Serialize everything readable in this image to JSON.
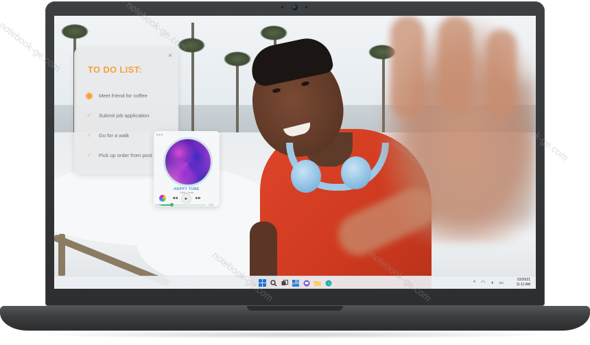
{
  "todo": {
    "title": "TO DO LIST:",
    "close": "×",
    "items": [
      {
        "label": "Meet friend for coffee",
        "done": false
      },
      {
        "label": "Submit job application",
        "done": true
      },
      {
        "label": "Go for a walk",
        "done": true
      },
      {
        "label": "Pick up order from post o",
        "done": true
      }
    ]
  },
  "music": {
    "menu": "•••",
    "title": "HAPPY TUNE",
    "artist": "Gabby Jonas",
    "progress": 0.25,
    "time_elapsed": "0:48",
    "time_total": "3:33"
  },
  "taskbar": {
    "tray": "^ ◠ ◖ ▭",
    "date": "10/20/21",
    "time": "11:11 AM"
  },
  "watermark": "notebook-ge.com",
  "colors": {
    "todo_title": "#f2a33a",
    "accent": "#1a73d6",
    "shirt": "#e0452a",
    "headphones": "#9fc9e8"
  }
}
